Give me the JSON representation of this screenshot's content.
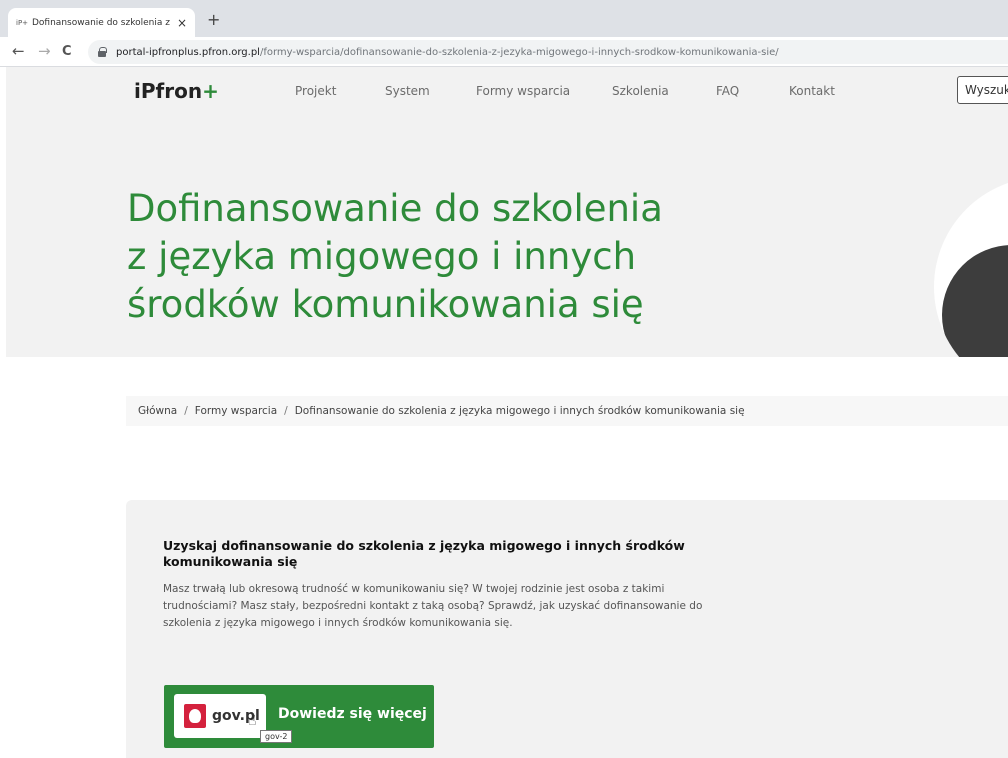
{
  "browser": {
    "tab_favicon": "iP+",
    "tab_title": "Dofinansowanie do szkolenia z j",
    "tab_close": "×",
    "new_tab": "+",
    "back": "←",
    "forward": "→",
    "reload": "C",
    "url_host": "portal-ipfronplus.pfron.org.pl",
    "url_path": "/formy-wsparcia/dofinansowanie-do-szkolenia-z-jezyka-migowego-i-innych-srodkow-komunikowania-sie/"
  },
  "nav": {
    "logo": "iPfron",
    "logo_plus": "+",
    "items": [
      "Projekt",
      "System",
      "Formy wsparcia",
      "Szkolenia",
      "FAQ",
      "Kontakt"
    ],
    "search": "Wyszukaj"
  },
  "hero": {
    "title_lines": [
      "Dofinansowanie do szkolenia",
      "z języka migowego i innych",
      "środków komunikowania się"
    ]
  },
  "breadcrumb": {
    "items": [
      "Główna",
      "Formy wsparcia",
      "Dofinansowanie do szkolenia z języka migowego i innych środków komunikowania się"
    ],
    "separator": "/"
  },
  "card": {
    "title": "Uzyskaj dofinansowanie do szkolenia z języka migowego i innych środków komunikowania się",
    "text": "Masz trwałą lub okresową trudność w komunikowaniu się? W twojej rodzinie jest osoba z takimi trudnościami? Masz stały, bezpośredni kontakt z taką osobą? Sprawdź, jak uzyskać dofinansowanie do szkolenia z języka migowego i innych środków komunikowania się.",
    "gov_logo_text": "gov.pl",
    "button_label": "Dowiedz się więcej",
    "tooltip": "gov-2"
  },
  "colors": {
    "brand_green": "#2e8b3a",
    "emblem_red": "#d4213d"
  }
}
